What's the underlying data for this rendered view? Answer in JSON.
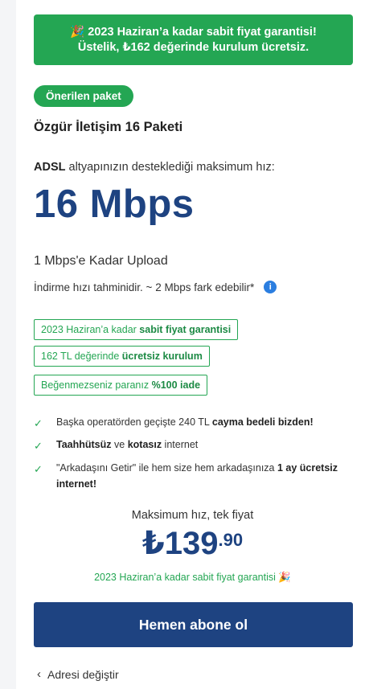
{
  "promo": {
    "line1": "🎉 2023 Haziran’a kadar sabit fiyat garantisi!",
    "line2": "Üstelik, ₺162 değerinde kurulum ücretsiz."
  },
  "badge": "Önerilen paket",
  "package_name": "Özgür İletişim 16 Paketi",
  "infra": {
    "bold": "ADSL",
    "rest": " altyapınızın desteklediği maksimum hız:"
  },
  "speed": "16 Mbps",
  "upload": "1 Mbps'e Kadar Upload",
  "download_note": "İndirme hızı tahminidir. ~ 2 Mbps fark edebilir*",
  "info_icon": "i",
  "tags": [
    {
      "pre": "2023 Haziran’a kadar ",
      "bold": "sabit fiyat garantisi",
      "post": ""
    },
    {
      "pre": "162 TL değerinde ",
      "bold": "ücretsiz kurulum",
      "post": ""
    },
    {
      "pre": "Beğenmezseniz paranız ",
      "bold": "%100 iade",
      "post": ""
    }
  ],
  "features": [
    {
      "p1": "Başka operatörden geçişte 240 TL ",
      "b1": "cayma bedeli bizden!",
      "p2": "",
      "b2": "",
      "p3": ""
    },
    {
      "p1": "",
      "b1": "Taahhütsüz",
      "p2": " ve ",
      "b2": "kotasız",
      "p3": " internet"
    },
    {
      "p1": "\"Arkadaşını Getir\" ile hem size hem arkadaşınıza ",
      "b1": "1 ay ücretsiz internet!",
      "p2": "",
      "b2": "",
      "p3": ""
    }
  ],
  "check_glyph": "✓",
  "price": {
    "title": "Maksimum hız, tek fiyat",
    "main": "₺139",
    "cents": ".90"
  },
  "guarantee": "2023 Haziran’a kadar sabit fiyat garantisi 🎉",
  "cta": "Hemen abone ol",
  "back": {
    "chevron": "‹",
    "label": "Adresi değiştir"
  },
  "colors": {
    "green": "#24a653",
    "navy": "#1e4381",
    "info_blue": "#2b7ee0"
  }
}
